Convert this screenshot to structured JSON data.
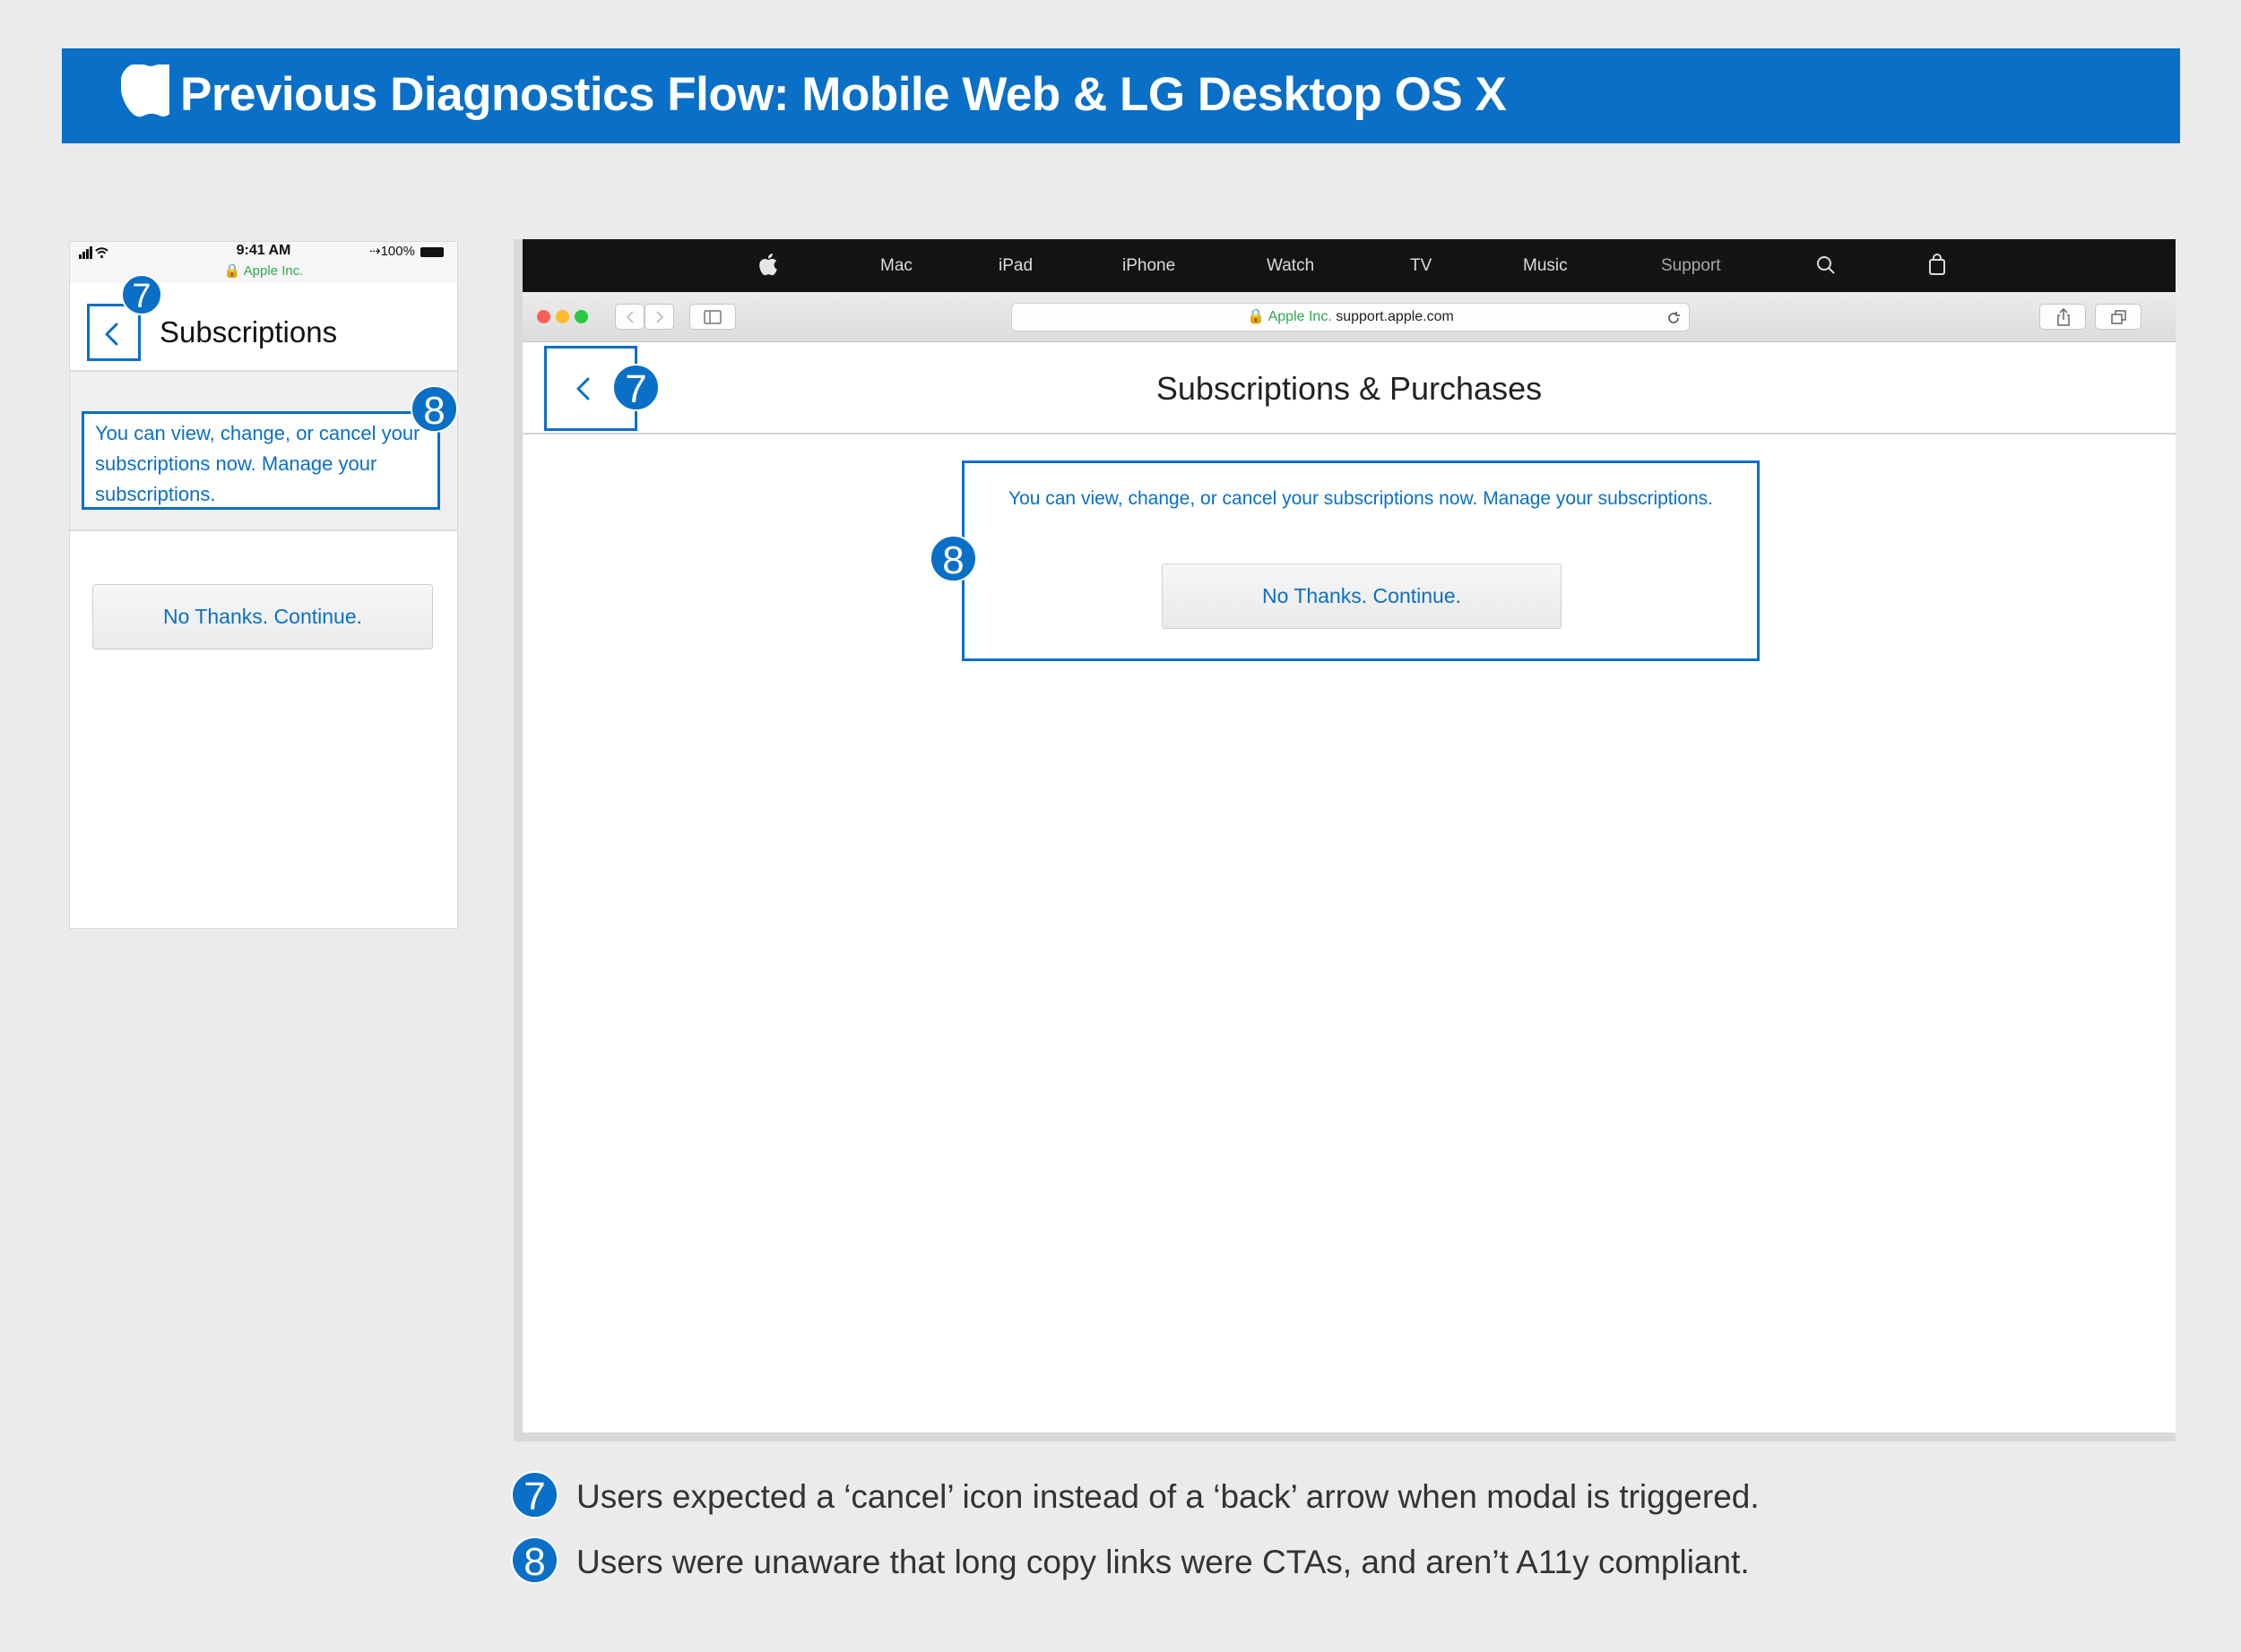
{
  "banner": {
    "title": "Previous Diagnostics Flow: Mobile Web & LG Desktop OS X",
    "logo_icon": "apple-logo-icon"
  },
  "colors": {
    "accent": "#0a6fc7",
    "background": "#ebebeb",
    "secure_green": "#2fa84f",
    "nav_bar": "#141414"
  },
  "phone": {
    "status": {
      "time": "9:41 AM",
      "battery": "100%",
      "secure_label": "Apple Inc."
    },
    "title": "Subscriptions",
    "copy": "You can view, change, or cancel your subscriptions now. Manage your subscriptions.",
    "button": "No Thanks. Continue."
  },
  "desktop": {
    "nav": {
      "items": [
        "Mac",
        "iPad",
        "iPhone",
        "Watch",
        "TV",
        "Music",
        "Support"
      ],
      "icons": [
        "apple-logo-icon",
        "search-icon",
        "bag-icon"
      ]
    },
    "url": {
      "secure_label": "Apple Inc.",
      "domain": "support.apple.com"
    },
    "title": "Subscriptions & Purchases",
    "copy": "You can view, change, or cancel your subscriptions now. Manage your subscriptions.",
    "button": "No Thanks. Continue."
  },
  "badges": {
    "seven": "7",
    "eight": "8"
  },
  "notes": [
    {
      "num": "7",
      "text": "Users expected a ‘cancel’ icon instead of a ‘back’ arrow when modal is triggered."
    },
    {
      "num": "8",
      "text": "Users were unaware that long copy links were CTAs, and aren’t A11y compliant."
    }
  ]
}
